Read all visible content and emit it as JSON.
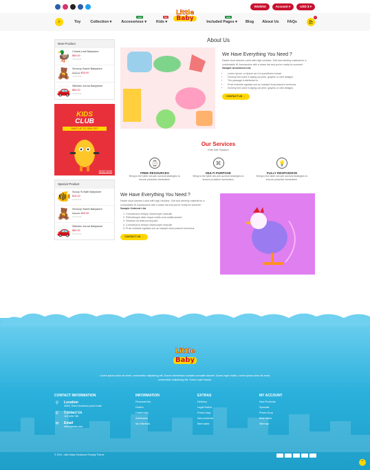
{
  "topbar": {
    "wishlist": "Wishlist",
    "account": "Account",
    "currency": "USD $"
  },
  "nav": {
    "left": [
      "Toy",
      "Collection",
      "Accesoriese",
      "Kids"
    ],
    "accesoriese_badge": "new",
    "kids_badge": "hot",
    "right": [
      "Included Pages",
      "Blog",
      "About Us",
      "FAQs"
    ],
    "included_badge": "new",
    "cart_count": "0"
  },
  "logo": {
    "line1": "Little",
    "line2": "Baby"
  },
  "page_title": "About Us",
  "sidebar": {
    "new_product_title": "New Product",
    "new_products": [
      {
        "name": "Crinkle-Leaf Babystore",
        "old": "",
        "price": "$60.00",
        "emoji": "🦆"
      },
      {
        "name": "Sensory Sweet Babystore",
        "old": "$38.00",
        "price": "$25.00",
        "emoji": "🧸"
      },
      {
        "name": "Skillofun Jumar Babystore",
        "old": "",
        "price": "$69.00",
        "emoji": "🚗"
      }
    ],
    "banner": {
      "l1": "KIDS",
      "l2": "CLUB",
      "offer": "SAVE UP TO 35% OFF",
      "cta": "SHOP NOW"
    },
    "special_title": "Special Product",
    "special_products": [
      {
        "name": "Scoop 'N Bath Babystore",
        "old": "",
        "price": "$15.00",
        "emoji": "🐠"
      },
      {
        "name": "Sensory Sweet Babystore",
        "old": "$38.00",
        "price": "$25.00",
        "emoji": "🧸"
      },
      {
        "name": "Skillofun Jumar Babystore",
        "old": "",
        "price": "$65.00",
        "emoji": "🚗"
      }
    ]
  },
  "section1": {
    "heading": "We Have Everything You Need ?",
    "para": "Pastel short sleeves t-shirt with high neckline. Soft and stretchy material for a comfortable fit. Accessorize with a straw hat and you're ready for summer!",
    "list_title": "Sample Unordered List",
    "items": [
      "Lorem ipsum, or lipsum as it is sometimes known",
      "Dummy text used in laying out print, graphic or web designs",
      "The passage is attributed to",
      "Proin molestie egestas orci ac suscipit risus posuere loremous.",
      "Dummy text used in laying out print, graphic or web designs"
    ],
    "button": "CONTACT US →"
  },
  "services": {
    "title": "Our Services",
    "subtitle": "Kids Soft Toystore",
    "items": [
      {
        "title": "FREE RESOURCES",
        "text": "Bring to the table win-win survival strategies to ensure proactive domination.",
        "icon": "⌚"
      },
      {
        "title": "MULTI PURPOSE",
        "text": "Bring to the table win-win survival strategies to ensure proactive domination.",
        "icon": "⌘"
      },
      {
        "title": "FULLY RESPONSIVE",
        "text": "Bring to the table win-win survival strategies to ensure proactive domination.",
        "icon": "💡"
      }
    ]
  },
  "section2": {
    "heading": "We Have Everything You Need ?",
    "para": "Pastel short sleeves t-shirt with high neckline. Soft and stretchy material for a comfortable fit. Accessorize with a straw hat and you're ready for summer!",
    "list_title": "Sample Ordered List",
    "items": [
      "Comodous in tempor ullamcorper miaculis",
      "Pellentesque vitae neque mollis urna mattis laoreet.",
      "Divamus sit amet purus justo.",
      "Comodous in tempor ullamcorper miaculis",
      "Proin molestie egestas orci ac suscipit risus posuere loremous."
    ],
    "button": "CONTACT US →"
  },
  "footer": {
    "logo1": "Little",
    "logo2": "Baby",
    "desc": "Lorem ipsum dolor sit amet, consectetur adipiscing elit. Donec elementum sodales convallis laoreet. Donec eget mollis. Lorem ipsum dolor sit amet, consectetur adipiscing elit. Donec eget mauris.",
    "contact_title": "CONTACT INFORMATION",
    "location_label": "Location",
    "location_value": "4005, Silver business point India",
    "contact_label": "Contact Us",
    "contact_value": "123 456 789",
    "email_label": "Email",
    "email_value": "info@gmail.com",
    "info_title": "INFORMATION",
    "info": [
      "Personal Info",
      "Orders",
      "Credit slips",
      "Addresses",
      "My Wishlists"
    ],
    "extras_title": "EXTRAS",
    "extras": [
      "Delivery",
      "Legal Notice",
      "Prices drop",
      "New products",
      "Best sales"
    ],
    "account_title": "MY ACCOUNT",
    "account": [
      "New Products",
      "Specials",
      "Prices Drop",
      "Best Sales",
      "Sitemap"
    ],
    "copyright": "© 2021, Little Baby Sectioned Shopify Theme"
  }
}
